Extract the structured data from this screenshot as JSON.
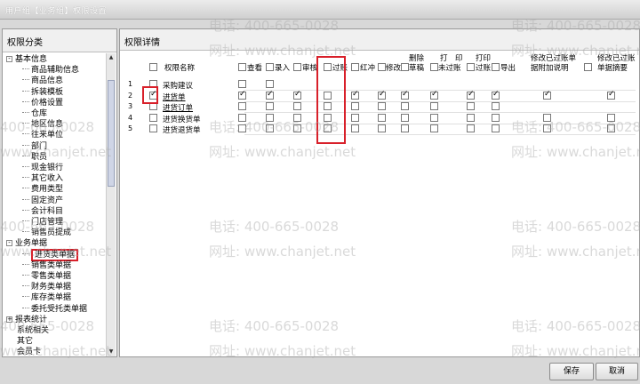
{
  "window": {
    "title": "用户组【业务组】权限设置"
  },
  "left": {
    "header": "权限分类",
    "tree": [
      {
        "label": "基本信息",
        "level": 0,
        "toggle": "-"
      },
      {
        "label": "商品辅助信息",
        "level": 2
      },
      {
        "label": "商品信息",
        "level": 2
      },
      {
        "label": "拆装模板",
        "level": 2
      },
      {
        "label": "价格设置",
        "level": 2
      },
      {
        "label": "仓库",
        "level": 2
      },
      {
        "label": "地区信息",
        "level": 2
      },
      {
        "label": "往来单位",
        "level": 2
      },
      {
        "label": "部门",
        "level": 2
      },
      {
        "label": "职员",
        "level": 2
      },
      {
        "label": "现金银行",
        "level": 2
      },
      {
        "label": "其它收入",
        "level": 2
      },
      {
        "label": "费用类型",
        "level": 2
      },
      {
        "label": "固定资产",
        "level": 2
      },
      {
        "label": "会计科目",
        "level": 2
      },
      {
        "label": "门店管理",
        "level": 2
      },
      {
        "label": "销售员提成",
        "level": 2
      },
      {
        "label": "业务单据",
        "level": 0,
        "toggle": "-"
      },
      {
        "label": "进货类单据",
        "level": 2,
        "selected": true
      },
      {
        "label": "销售类单据",
        "level": 2
      },
      {
        "label": "零售类单据",
        "level": 2
      },
      {
        "label": "财务类单据",
        "level": 2
      },
      {
        "label": "库存类单据",
        "level": 2
      },
      {
        "label": "委托受托类单据",
        "level": 2
      },
      {
        "label": "报表统计",
        "level": 0,
        "toggle": "+"
      },
      {
        "label": "系统相关",
        "level": 1
      },
      {
        "label": "其它",
        "level": 1
      },
      {
        "label": "会员卡",
        "level": 1
      }
    ]
  },
  "right": {
    "header": "权限详情",
    "columns": {
      "name": "权限名称",
      "view": "查看",
      "entry": "录入",
      "audit": "审核",
      "post": "过账",
      "red": "红冲",
      "modify": "修改",
      "delete_draft_1": "删除",
      "delete_draft_2": "草稿",
      "print_unposted_1": "打　印",
      "print_unposted_2": "未过账",
      "print_posted_1": "打印",
      "print_posted_2": "过账",
      "export": "导出",
      "modify_posted_note_1": "修改已过账单",
      "modify_posted_note_2": "据附加说明",
      "modify_posted_summary_1": "修改已过账",
      "modify_posted_summary_2": "单据摘要"
    },
    "rows": [
      {
        "num": "1",
        "name": "采购建议",
        "checked": false,
        "link": false,
        "perms": [
          false,
          false,
          null,
          null,
          null,
          null,
          null,
          null,
          null,
          null,
          null,
          null
        ]
      },
      {
        "num": "2",
        "name": "进货单",
        "checked": true,
        "link": true,
        "perms": [
          true,
          true,
          true,
          false,
          true,
          true,
          true,
          true,
          true,
          true,
          true,
          true
        ]
      },
      {
        "num": "3",
        "name": "进货订单",
        "checked": false,
        "link": true,
        "perms": [
          false,
          false,
          false,
          false,
          false,
          false,
          false,
          false,
          false,
          false,
          null,
          null
        ]
      },
      {
        "num": "4",
        "name": "进货换货单",
        "checked": false,
        "link": false,
        "perms": [
          false,
          false,
          false,
          false,
          false,
          false,
          false,
          false,
          false,
          false,
          false,
          false
        ]
      },
      {
        "num": "5",
        "name": "进货退货单",
        "checked": false,
        "link": false,
        "perms": [
          false,
          false,
          false,
          false,
          false,
          false,
          false,
          false,
          false,
          false,
          false,
          false
        ]
      }
    ]
  },
  "watermark": {
    "phone": "电话: 400-665-0028",
    "site": "网址: www.chanjet.net"
  },
  "footer": {
    "save": "保存",
    "cancel": "取消"
  }
}
